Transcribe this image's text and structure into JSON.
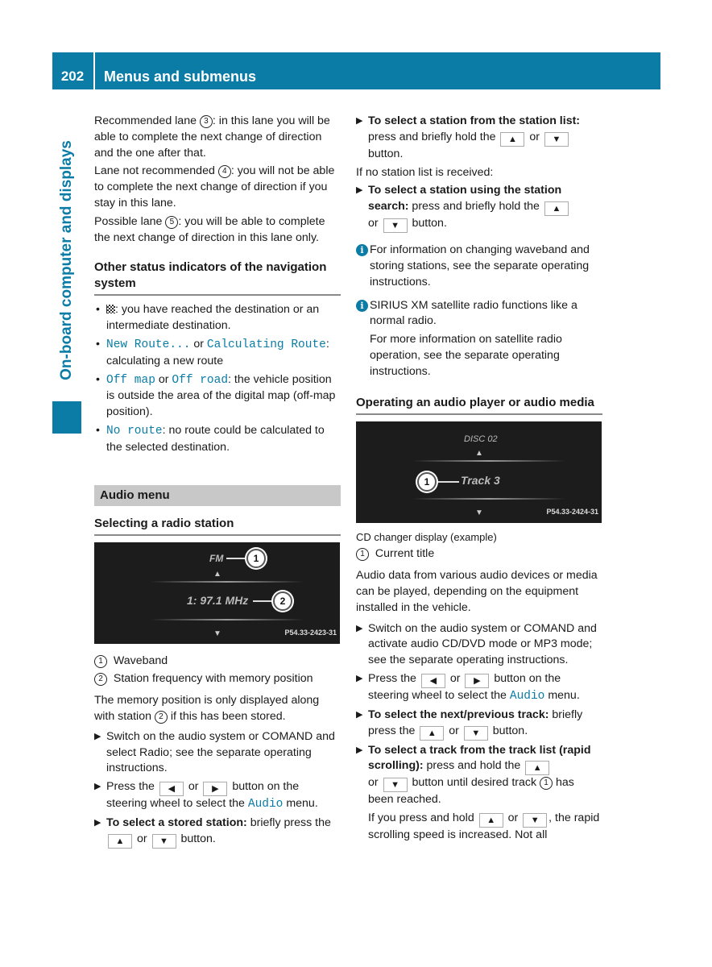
{
  "header": {
    "page_number": "202",
    "title": "Menus and submenus"
  },
  "sidebar": {
    "section_label": "On-board computer and displays"
  },
  "colors": {
    "brand_blue": "#0a7ca6",
    "section_gray": "#c8c8c8"
  },
  "col1": {
    "lane_paras": [
      {
        "pre": "Recommended lane ",
        "num": "3",
        "post": ": in this lane you will be able to complete the next change of direction and the one after that."
      },
      {
        "pre": "Lane not recommended ",
        "num": "4",
        "post": ": you will not be able to complete the next change of direction if you stay in this lane."
      },
      {
        "pre": "Possible lane ",
        "num": "5",
        "post": ": you will be able to complete the next change of direction in this lane only."
      }
    ],
    "status_heading": "Other status indicators of the navigation system",
    "status_items": [
      {
        "icon": "checkered-flag-icon",
        "text": ": you have reached the destination or an intermediate destination."
      },
      {
        "code1": "New Route...",
        "mid": " or ",
        "code2": "Calculating Route",
        "text": ": calculating a new route"
      },
      {
        "code1": "Off map",
        "mid": " or ",
        "code2": "Off road",
        "text": ": the vehicle position is outside the area of the digital map (off-map position)."
      },
      {
        "code1": "No route",
        "text": ": no route could be calculated to the selected destination."
      }
    ],
    "audio_menu_label": "Audio menu",
    "radio_heading": "Selecting a radio station",
    "radio_screen": {
      "waveband": "FM",
      "frequency": "1: 97.1 MHz",
      "code": "P54.33-2423-31",
      "callout1": "1",
      "callout2": "2"
    },
    "legend": [
      {
        "num": "1",
        "text": "Waveband"
      },
      {
        "num": "2",
        "text": "Station frequency with memory position"
      }
    ],
    "memory_para": {
      "pre": "The memory position is only displayed along with station ",
      "num": "2",
      "post": " if this has been stored."
    },
    "steps": {
      "switch_on": "Switch on the audio system or COMAND and select Radio; see the separate operating instructions.",
      "press_pre": "Press the ",
      "or": " or ",
      "press_post": " button on the steering wheel to select the ",
      "audio_code": "Audio",
      "menu": " menu.",
      "stored_bold": "To select a stored station:",
      "stored_post": " briefly press the ",
      "button": " button."
    },
    "keys": {
      "left": "◀",
      "right": "▶",
      "up": "▲",
      "down": "▼"
    }
  },
  "col2": {
    "list_bold": "To select a station from the station list:",
    "list_post": " press and briefly hold the ",
    "or": " or ",
    "button": " button.",
    "no_list": "If no station list is received:",
    "search_bold": "To select a station using the station search:",
    "search_post": " press and briefly hold the ",
    "info1": "For information on changing waveband and storing stations, see the separate operating instructions.",
    "info2": "SIRIUS XM satellite radio functions like a normal radio.",
    "info2b": "For more information on satellite radio operation, see the separate operating instructions.",
    "player_heading": "Operating an audio player or audio media",
    "cd_screen": {
      "disc": "DISC 02",
      "track": "Track 3",
      "code": "P54.33-2424-31",
      "callout1": "1"
    },
    "cd_caption": "CD changer display (example)",
    "cd_legend": {
      "num": "1",
      "text": "Current title"
    },
    "audio_data_para": "Audio data from various audio devices or media can be played, depending on the equipment installed in the vehicle.",
    "switch_on": "Switch on the audio system or COMAND and activate audio CD/DVD mode or MP3 mode; see the separate operating instructions.",
    "press_pre": "Press the ",
    "press_post": " button on the steering wheel to select the ",
    "audio_code": "Audio",
    "menu": " menu.",
    "next_bold": "To select the next/previous track:",
    "next_post": " briefly press the ",
    "tracklist_bold": "To select a track from the track list (rapid scrolling):",
    "tracklist_post": " press and hold the ",
    "tracklist_end_pre": " button until desired track ",
    "tracklist_num": "1",
    "tracklist_end_post": " has been reached.",
    "hold_pre": "If you press and hold ",
    "hold_post": ", the rapid scrolling speed is increased. Not all"
  }
}
